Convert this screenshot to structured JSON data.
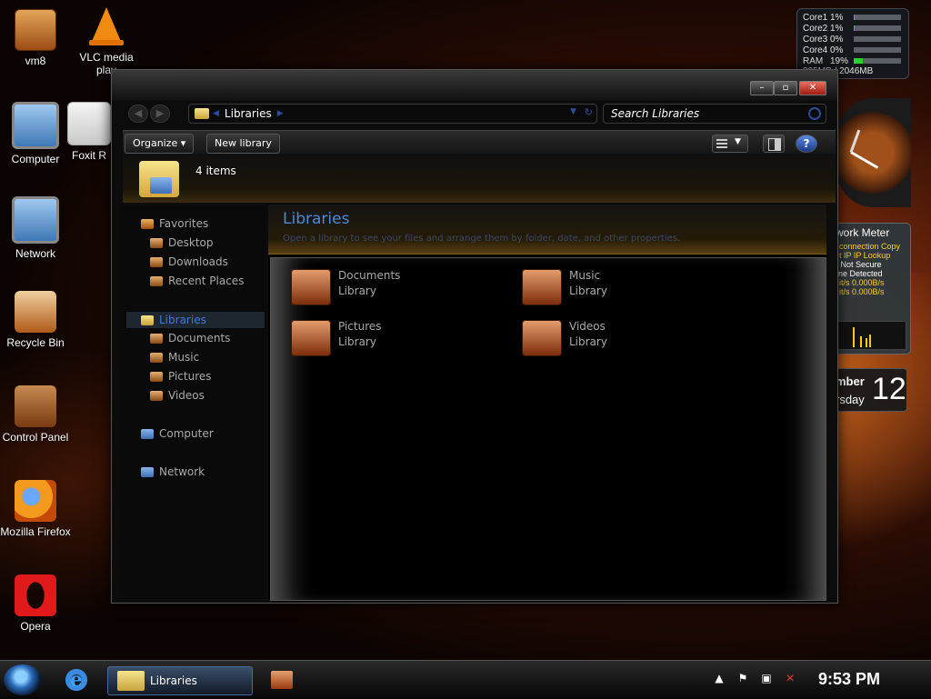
{
  "desktop": {
    "icons": [
      {
        "label": "vm8"
      },
      {
        "label": "VLC media play"
      },
      {
        "label": "Computer"
      },
      {
        "label": "Foxit R"
      },
      {
        "label": "Network"
      },
      {
        "label": "Recycle Bin"
      },
      {
        "label": "Control Panel"
      },
      {
        "label": "Mozilla Firefox"
      },
      {
        "label": "Opera"
      }
    ]
  },
  "gadgets": {
    "cpu": {
      "rows": [
        {
          "label": "Core1",
          "pct": "1%",
          "value": 0.01
        },
        {
          "label": "Core2",
          "pct": "1%",
          "value": 0.01
        },
        {
          "label": "Core3",
          "pct": "0%",
          "value": 0.0
        },
        {
          "label": "Core4",
          "pct": "0%",
          "value": 0.0
        },
        {
          "label": "RAM",
          "pct": "19%",
          "value": 0.19
        }
      ],
      "memory": "395MB / 2046MB"
    },
    "network_meter": {
      "title": "work Meter",
      "line1": "connection Copy",
      "line2": "t IP   IP Lookup",
      "line3": "t: Not Secure",
      "line4": "one Detected",
      "line5": "it/s   0.000B/s",
      "line6": "it/s   0.000B/s"
    },
    "calendar": {
      "month": "mber",
      "weekday": "rsday",
      "day": "12"
    }
  },
  "window": {
    "address": "Libraries",
    "search_placeholder": "Search Libraries",
    "toolbar": {
      "organize": "Organize ▾",
      "new_library": "New library",
      "help": "?"
    },
    "details": {
      "count": "4 items"
    },
    "nav": {
      "favorites": "Favorites",
      "desktop": "Desktop",
      "downloads": "Downloads",
      "recent": "Recent Places",
      "libraries": "Libraries",
      "documents": "Documents",
      "music": "Music",
      "pictures": "Pictures",
      "videos": "Videos",
      "computer": "Computer",
      "network": "Network"
    },
    "content": {
      "title": "Libraries",
      "subtitle": "Open a library to see your files and arrange them by folder, date, and other properties.",
      "items": [
        {
          "name": "Documents",
          "kind": "Library"
        },
        {
          "name": "Music",
          "kind": "Library"
        },
        {
          "name": "Pictures",
          "kind": "Library"
        },
        {
          "name": "Videos",
          "kind": "Library"
        }
      ]
    }
  },
  "taskbar": {
    "active_item": "Libraries",
    "time": "9:53 PM"
  }
}
